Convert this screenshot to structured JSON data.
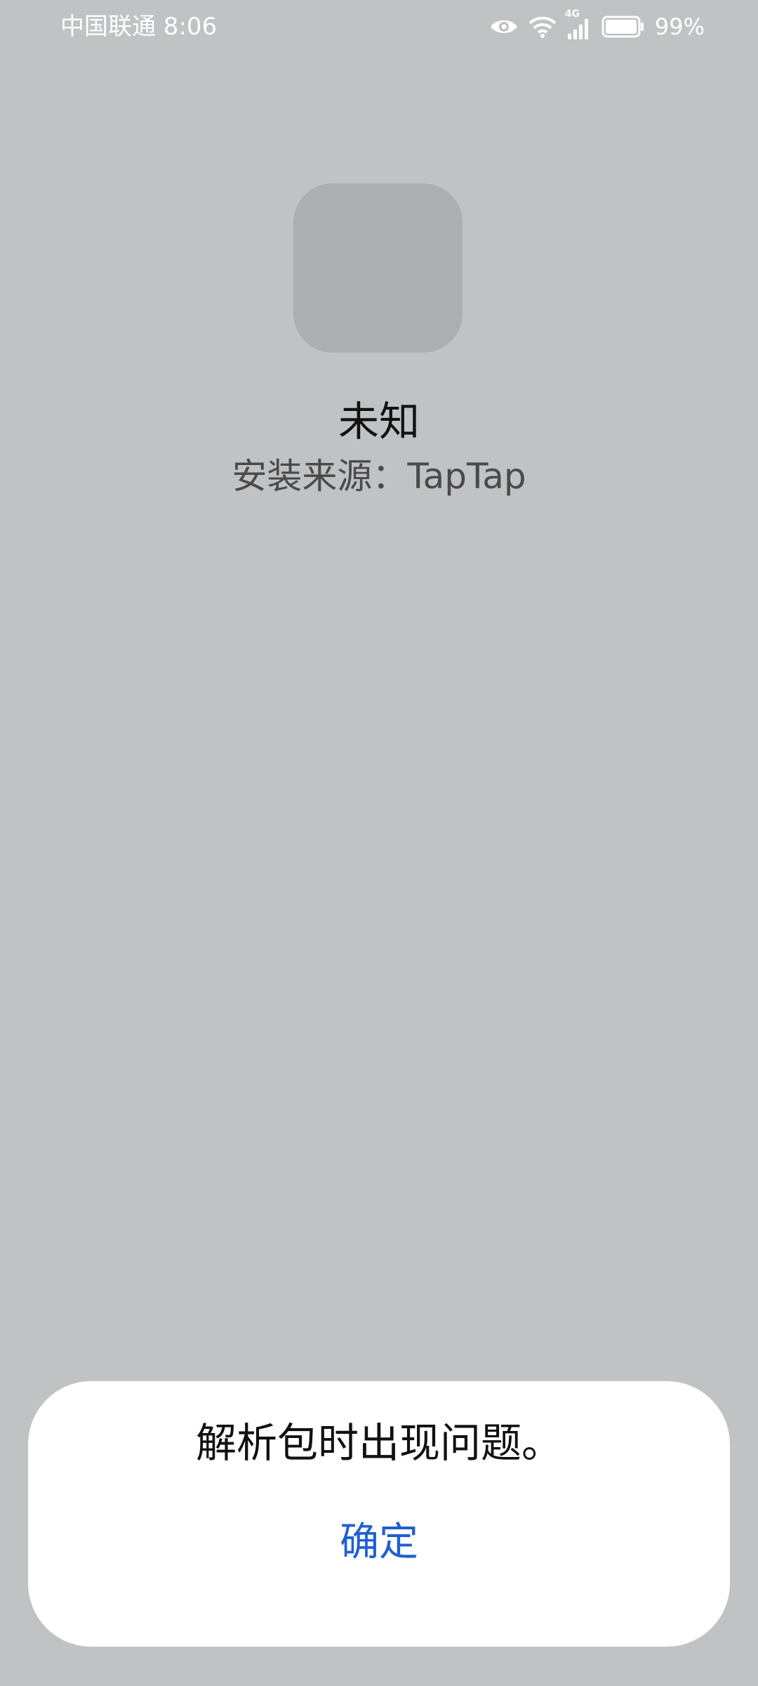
{
  "status_bar": {
    "carrier_time": "中国联通 8:06",
    "network_type": "4G",
    "battery_percent": "99%",
    "battery_level": 0.99,
    "icons": [
      "eye-icon",
      "wifi-icon",
      "cellular-signal-icon",
      "battery-icon"
    ]
  },
  "app": {
    "name": "未知",
    "install_source": "安装来源：TapTap"
  },
  "dialog": {
    "message": "解析包时出现问题。",
    "confirm_label": "确定"
  },
  "colors": {
    "background": "#c1c2c4",
    "icon_placeholder": "#adaeb0",
    "dialog_background": "#ffffff",
    "accent": "#1f5fd1"
  }
}
